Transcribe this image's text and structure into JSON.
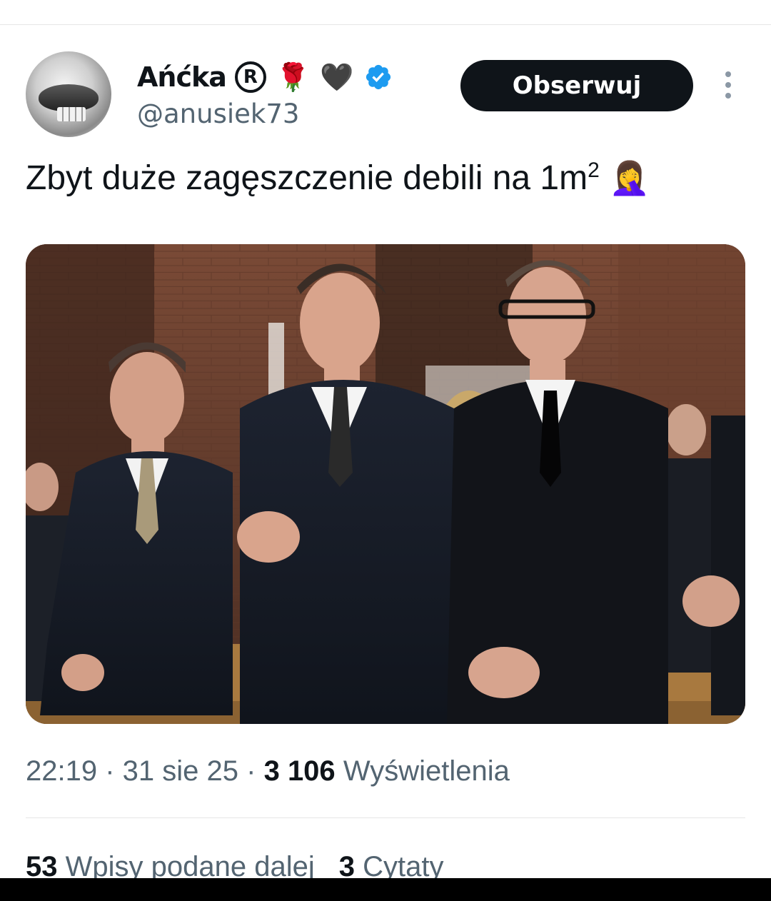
{
  "tweet": {
    "display_name": "Ańćka",
    "reg_symbol": "R",
    "name_emojis": [
      "🌹",
      "🖤"
    ],
    "handle": "@anusiek73",
    "follow_label": "Obserwuj",
    "text": "Zbyt duże zagęszczenie debili na 1m",
    "text_superscript": "2",
    "text_emoji": "🤦‍♀️",
    "time": "22:19",
    "date": "31 sie 25",
    "views_count": "3 106",
    "views_label": "Wyświetlenia",
    "reposts_count": "53",
    "reposts_label": "Wpisy podane dalej",
    "quotes_count": "3",
    "quotes_label": "Cytaty"
  },
  "icons": {
    "verified": "verified-badge-icon",
    "more": "more-vertical-icon"
  },
  "colors": {
    "text_primary": "#0f1419",
    "text_secondary": "#536471",
    "verified_blue": "#1d9bf0",
    "follow_button_bg": "#0f1419"
  }
}
